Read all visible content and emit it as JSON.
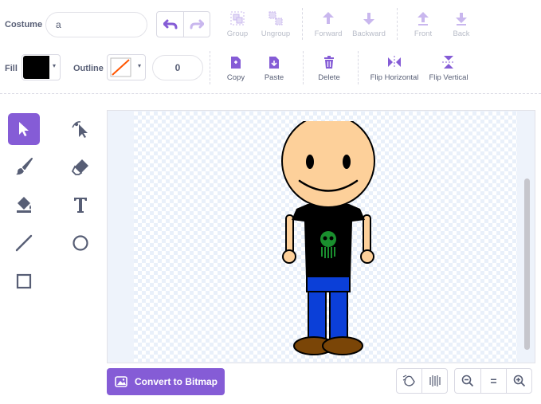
{
  "costume": {
    "label": "Costume",
    "name_value": "a"
  },
  "fill": {
    "label": "Fill",
    "color": "#000000"
  },
  "outline": {
    "label": "Outline",
    "color": "none",
    "width_value": "0"
  },
  "toolbar_row1": {
    "group": "Group",
    "ungroup": "Ungroup",
    "forward": "Forward",
    "backward": "Backward",
    "front": "Front",
    "back": "Back"
  },
  "toolbar_row2": {
    "copy": "Copy",
    "paste": "Paste",
    "delete": "Delete",
    "flip_horizontal": "Flip Horizontal",
    "flip_vertical": "Flip Vertical"
  },
  "tools": [
    "select-tool",
    "reshape-tool",
    "brush-tool",
    "eraser-tool",
    "fill-tool",
    "text-tool",
    "line-tool",
    "circle-tool",
    "rectangle-tool"
  ],
  "convert_button": "Convert to Bitmap",
  "zoom": {
    "out": "zoom-out",
    "reset": "=",
    "in": "zoom-in"
  },
  "colors": {
    "accent": "#855cd6",
    "text": "#575e75",
    "disabled": "#b8bcc8"
  }
}
